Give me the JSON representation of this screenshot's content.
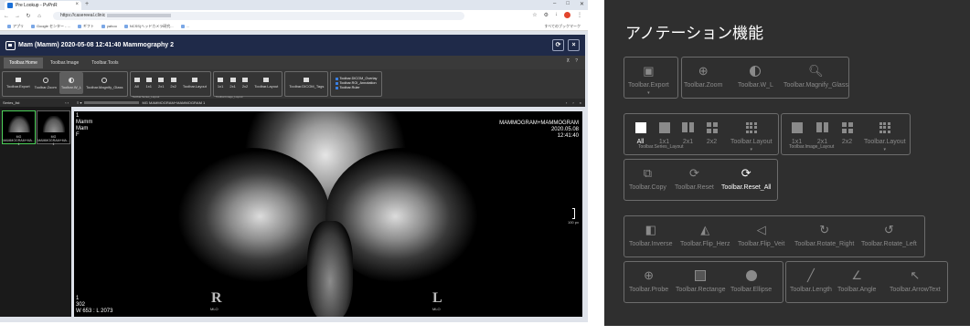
{
  "browser": {
    "tab_title": "Pre Lookup - PvPnR",
    "url_prefix": "https://casereeal.clinic",
    "bookmarks": [
      "アプリ",
      "Google センター - ...",
      "ギフト",
      "yahoo",
      "NCSS(ヘッドカメラ研究...",
      "..."
    ],
    "bookmarks_right": "すべてのブックマーク"
  },
  "app": {
    "title": "Mam (Mamm) 2020-05-08 12:41:40 Mammography 2",
    "tabs": [
      "Toolbar.Home",
      "Toolbar.Image",
      "Toolbar.Tools"
    ],
    "ribbon": {
      "export": "Toolbar.Export",
      "zoom": "Toolbar.Zoom",
      "wl": "Toolbar.W_L",
      "magnify": "Toolbar.Magnify_Glass",
      "series_layout": [
        "All",
        "1x1",
        "2x1",
        "2x2",
        "Toolbar.Layout"
      ],
      "series_layout_sub": "Toolbar.Series_Layout",
      "image_layout": [
        "1x1",
        "2x1",
        "2x2",
        "Toolbar.Layout"
      ],
      "image_layout_sub": "Toolbar.Image_Layout",
      "dicom_tags": "Toolbar.DICOM_Tags",
      "checks": [
        "Toolbar.DICOM_Overlay",
        "Toolbar.ROI_Annotation",
        "Toolbar.Ruler"
      ]
    },
    "series_list_label": "Series_list",
    "thumbs": [
      {
        "label": "MG MAMMOGRAM+MA... 1"
      },
      {
        "label": "MG MAMMOGRAM+MA... 1"
      }
    ],
    "viewer_header": "MG MAMMOGRAM+MAMMOGRAM 1",
    "overlay": {
      "tl": [
        "1",
        "Mamm",
        "Mam",
        "F"
      ],
      "tr": [
        "MAMMOGRAM+MAMMOGRAM",
        "2020.05.08",
        "12:41:40"
      ],
      "bl": [
        "1",
        "302",
        "W 653 : L 2073"
      ],
      "scale": "100 px"
    },
    "markers": {
      "r": "R",
      "l": "L",
      "r_sub": "MLO",
      "l_sub": "MLO"
    }
  },
  "panel": {
    "title": "アノテーション機能",
    "row1": {
      "export": "Toolbar.Export",
      "zoom": "Toolbar.Zoom",
      "wl": "Toolbar.W_L",
      "magnify": "Toolbar.Magnify_Glass"
    },
    "series_layout": [
      "All",
      "1x1",
      "2x1",
      "2x2",
      "Toolbar.Layout"
    ],
    "series_sub": "Toolbar.Series_Layout",
    "image_layout": [
      "1x1",
      "2x1",
      "2x2",
      "Toolbar.Layout"
    ],
    "image_sub": "Toolbar.Image_Layout",
    "copy": "Toolbar.Copy",
    "reset": "Toolbar.Reset",
    "reset_all": "Toolbar.Reset_All",
    "transform": [
      "Toolbar.Inverse",
      "Toolbar.Flip_Herz",
      "Toolbar.Flip_Veit",
      "Toolbar.Rotate_Right",
      "Toolbar.Rotate_Left"
    ],
    "measure": [
      "Toolbar.Probe",
      "Toolbar.Rectange",
      "Toolbar.Ellipse"
    ],
    "draw": [
      "Toolbar.Length",
      "Toolbar.Angle",
      "Toolbar.ArrowText"
    ]
  }
}
